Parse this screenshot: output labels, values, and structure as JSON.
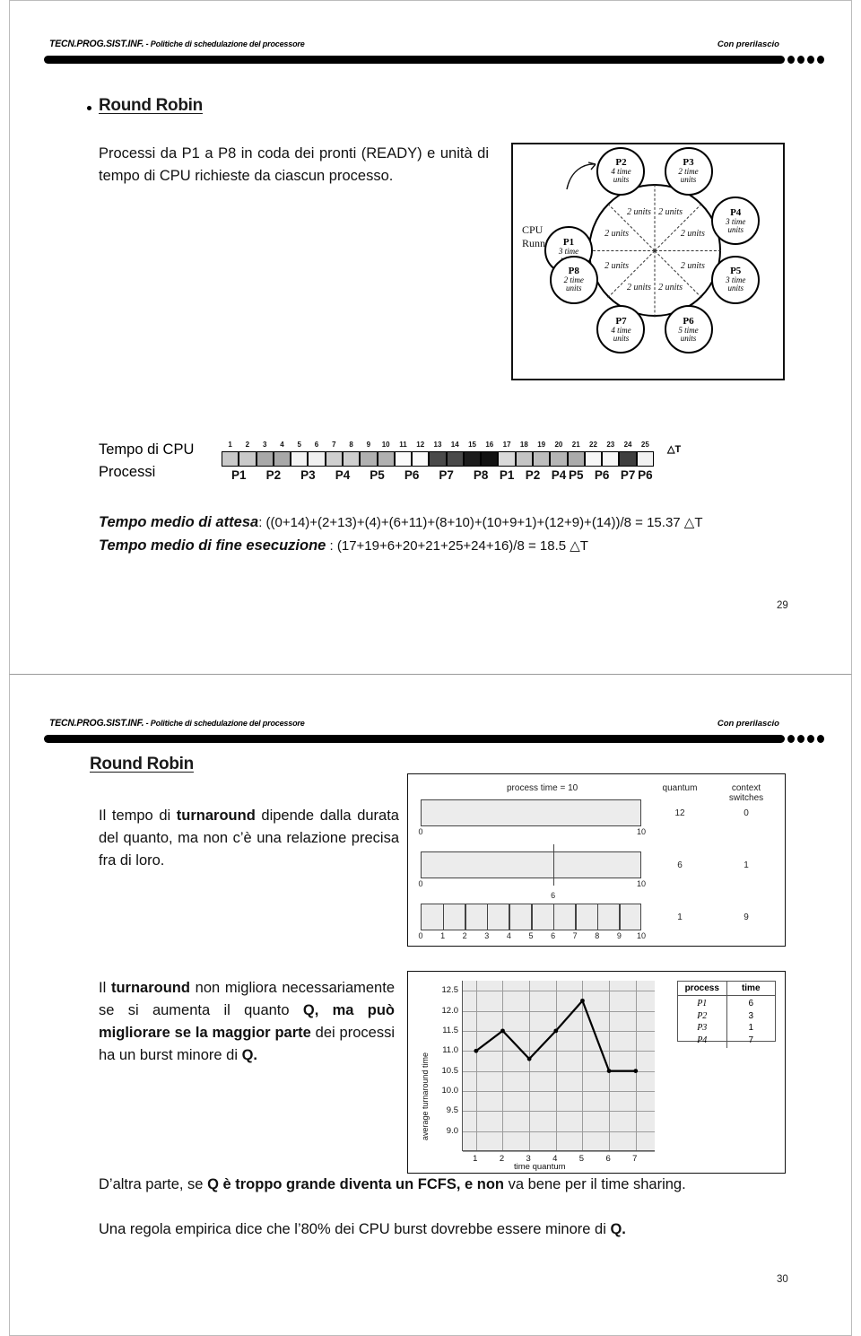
{
  "document": {
    "slides": [
      {
        "page_number": "29",
        "header": {
          "left_small_caps": "TECN.PROG.SIST.INF.",
          "left_rest": " - Politiche di schedulazione del processore",
          "right": "Con  prerilascio"
        },
        "title": "Round Robin",
        "body": {
          "line1": "Processi da P1 a P8  in coda dei pronti  (READY) e",
          "line2": "unità di tempo di CPU richieste da ciascun",
          "line3": "processo."
        },
        "gantt": {
          "label_time": "Tempo di CPU",
          "label_processes": "Processi",
          "delta_symbol": "△T",
          "ticks": [
            "1",
            "2",
            "3",
            "4",
            "5",
            "6",
            "7",
            "8",
            "9",
            "10",
            "11",
            "12",
            "13",
            "14",
            "15",
            "16",
            "17",
            "18",
            "19",
            "20",
            "21",
            "22",
            "23",
            "24",
            "25"
          ],
          "cell_colors": [
            "#c9c9c9",
            "#c9c9c9",
            "#a8a8a8",
            "#a8a8a8",
            "#f4f4f4",
            "#f0f0f0",
            "#cfcfcf",
            "#cfcfcf",
            "#b0b0b0",
            "#b0b0b0",
            "#fbfbfb",
            "#fbfbfb",
            "#4a4a4a",
            "#4a4a4a",
            "#1c1c1c",
            "#121212",
            "#d9d9d9",
            "#c4c4c4",
            "#bdbdbd",
            "#b5b5b5",
            "#ababab",
            "#f7f7f7",
            "#f7f7f7",
            "#3f3f3f",
            "#f2f2f2"
          ],
          "process_labels": [
            {
              "name": "P1",
              "start": 1,
              "span": 2
            },
            {
              "name": "P2",
              "start": 3,
              "span": 2
            },
            {
              "name": "P3",
              "start": 5,
              "span": 2
            },
            {
              "name": "P4",
              "start": 7,
              "span": 2
            },
            {
              "name": "P5",
              "start": 9,
              "span": 2
            },
            {
              "name": "P6",
              "start": 11,
              "span": 2
            },
            {
              "name": "P7",
              "start": 13,
              "span": 2
            },
            {
              "name": "P8",
              "start": 15,
              "span": 2
            },
            {
              "name": "P1",
              "start": 17,
              "span": 1
            },
            {
              "name": "P2",
              "start": 18,
              "span": 2
            },
            {
              "name": "P4",
              "start": 20,
              "span": 1
            },
            {
              "name": "P5",
              "start": 21,
              "span": 1
            },
            {
              "name": "P6",
              "start": 22,
              "span": 2
            },
            {
              "name": "P7",
              "start": 24,
              "span": 1
            },
            {
              "name": "P6",
              "start": 25,
              "span": 1
            }
          ]
        },
        "formulas": {
          "wait_label": "Tempo medio di attesa",
          "wait_body": ":  ((0+14)+(2+13)+(4)+(6+11)+(8+10)+(10+9+1)+(12+9)+(14))/8 = 15.37  △T",
          "finish_label": "Tempo medio di fine esecuzione",
          "finish_body": " :  (17+19+6+20+21+25+24+16)/8 = 18.5  △T"
        },
        "figure_circle": {
          "cpu_label_line1": "CPU",
          "cpu_label_line2": "Running",
          "unit_text": "2 units",
          "unit_slices": 8,
          "processes": [
            {
              "id": "P1",
              "time": "3 time",
              "units": "units"
            },
            {
              "id": "P2",
              "time": "4 time",
              "units": "units"
            },
            {
              "id": "P3",
              "time": "2 time",
              "units": "units"
            },
            {
              "id": "P4",
              "time": "3 time",
              "units": "units"
            },
            {
              "id": "P5",
              "time": "3 time",
              "units": "units"
            },
            {
              "id": "P6",
              "time": "5 time",
              "units": "units"
            },
            {
              "id": "P7",
              "time": "4 time",
              "units": "units"
            },
            {
              "id": "P8",
              "time": "2 time",
              "units": "units"
            }
          ]
        }
      },
      {
        "page_number": "30",
        "header": {
          "left_small_caps": "TECN.PROG.SIST.INF.",
          "left_rest": " - Politiche di schedulazione del processore",
          "right": "Con  prerilascio"
        },
        "title": "Round Robin",
        "para1": {
          "l1a": "Il tempo di ",
          "l1b": "turnaround",
          "l1c": " dipende",
          "l2": "dalla durata del quanto, ma non",
          "l3": "c’è una relazione precisa fra di",
          "l4": "loro."
        },
        "para2": {
          "a": "Il ",
          "b_turnaround": "turnaround",
          "c": " non migliora necessariamente se si aumenta il quanto ",
          "d_bold": "Q, ma può migliorare se la maggior parte",
          "e": " dei processi ha un burst minore di ",
          "f_bold": "Q."
        },
        "para3": {
          "a": "D’altra parte, se ",
          "b_bold": "Q è troppo grande diventa un FCFS, e non",
          "c": " va bene per il time sharing."
        },
        "para4": {
          "a": "Una regola empirica dice che l’80% dei CPU burst dovrebbe essere minore di ",
          "b_bold": "Q."
        },
        "figure_quantum": {
          "process_time_title": "process time = 10",
          "col_quantum": "quantum",
          "col_context_l1": "context",
          "col_context_l2": "switches",
          "rows": [
            {
              "quantum": "12",
              "context_switches": "0",
              "ticks": [
                "0",
                "10"
              ],
              "divisions": []
            },
            {
              "quantum": "6",
              "context_switches": "1",
              "ticks": [
                "0",
                "10"
              ],
              "divisions": [
                "6"
              ]
            },
            {
              "quantum": "1",
              "context_switches": "9",
              "ticks": [
                "0",
                "1",
                "2",
                "3",
                "4",
                "5",
                "6",
                "7",
                "8",
                "9",
                "10"
              ],
              "divisions": [
                "1",
                "2",
                "3",
                "4",
                "5",
                "6",
                "7",
                "8",
                "9"
              ]
            }
          ]
        },
        "figure_chart_table": {
          "headers": [
            "process",
            "time"
          ],
          "rows": [
            {
              "process": "P",
              "sub": "1",
              "time": "6"
            },
            {
              "process": "P",
              "sub": "2",
              "time": "3"
            },
            {
              "process": "P",
              "sub": "3",
              "time": "1"
            },
            {
              "process": "P",
              "sub": "4",
              "time": "7"
            }
          ]
        }
      }
    ]
  },
  "chart_data": {
    "type": "line",
    "title": "",
    "xlabel": "time quantum",
    "ylabel": "average turnaround time",
    "x": [
      1,
      2,
      3,
      4,
      5,
      6,
      7
    ],
    "values": [
      11.0,
      11.5,
      10.8,
      11.5,
      12.25,
      10.5,
      10.5
    ],
    "xticks": [
      "1",
      "2",
      "3",
      "4",
      "5",
      "6",
      "7"
    ],
    "yticks": [
      "12.5",
      "12.0",
      "11.5",
      "11.0",
      "10.5",
      "10.0",
      "9.5",
      "9.0"
    ],
    "ylim": [
      8.5,
      12.75
    ],
    "xlim": [
      0.5,
      7.75
    ],
    "grid": true,
    "legend": "none",
    "series": [
      {
        "name": "average turnaround time",
        "values": [
          11.0,
          11.5,
          10.8,
          11.5,
          12.25,
          10.5,
          10.5
        ]
      }
    ],
    "table": {
      "headers": [
        "process",
        "time"
      ],
      "rows": [
        [
          "P1",
          "6"
        ],
        [
          "P2",
          "3"
        ],
        [
          "P3",
          "1"
        ],
        [
          "P4",
          "7"
        ]
      ]
    }
  }
}
